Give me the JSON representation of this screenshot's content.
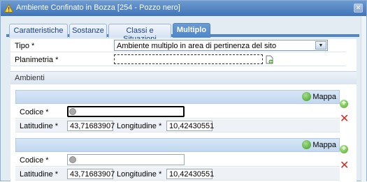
{
  "window": {
    "title": "Ambiente Confinato in Bozza [254 - Pozzo nero]",
    "close": "✕"
  },
  "tabs": [
    {
      "label": "Caratteristiche",
      "active": false
    },
    {
      "label": "Sostanze",
      "active": false
    },
    {
      "label": "Classi e Situazioni",
      "active": false
    },
    {
      "label": "Multiplo",
      "active": true
    }
  ],
  "form": {
    "tipo_label": "Tipo *",
    "tipo_value": "Ambiente multiplo in area di pertinenza del sito",
    "planimetria_label": "Planimetria *",
    "planimetria_value": ""
  },
  "section": {
    "title": "Ambienti"
  },
  "ambienti": [
    {
      "map_label": "Mappa",
      "codice_label": "Codice *",
      "codice_value": "",
      "lat_label": "Latitudine *",
      "lat_value": "43,71683907",
      "lon_label": "Longitudine *",
      "lon_value": "10,42430551"
    },
    {
      "map_label": "Mappa",
      "codice_label": "Codice *",
      "codice_value": "",
      "lat_label": "Latitudine *",
      "lat_value": "43,71683907",
      "lon_label": "Longitudine *",
      "lon_value": "10,42430551"
    }
  ],
  "icons": {
    "warning": "warning-icon",
    "add": "add-icon",
    "delete": "delete-icon",
    "globe": "globe-icon",
    "file": "file-add-icon"
  },
  "colors": {
    "titlebar": "#4a7fc1",
    "active_tab": "#4e86c6",
    "delete": "#d42a1e",
    "add": "#4ba82e"
  }
}
